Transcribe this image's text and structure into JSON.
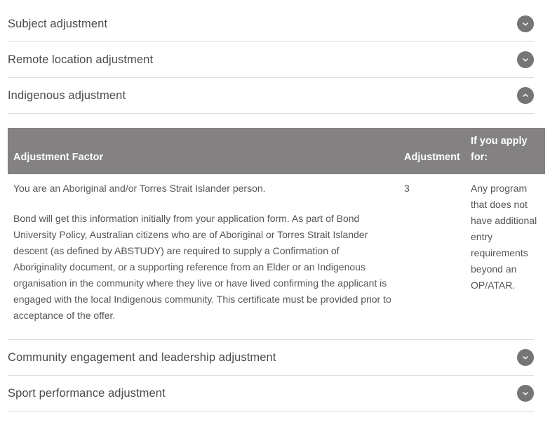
{
  "accordion": {
    "items": [
      {
        "title": "Subject adjustment",
        "expanded": false,
        "icon": "chevron-down-icon"
      },
      {
        "title": "Remote location adjustment",
        "expanded": false,
        "icon": "chevron-down-icon"
      },
      {
        "title": "Indigenous adjustment",
        "expanded": true,
        "icon": "chevron-up-icon"
      },
      {
        "title": "Community engagement and leadership adjustment",
        "expanded": false,
        "icon": "chevron-down-icon"
      },
      {
        "title": "Sport performance adjustment",
        "expanded": false,
        "icon": "chevron-down-icon"
      }
    ]
  },
  "indigenous_table": {
    "headers": [
      "Adjustment Factor",
      "Adjustment",
      "If you apply for:"
    ],
    "rows": [
      {
        "factor_paragraphs": [
          "You are an Aboriginal and/or Torres Strait Islander person.",
          "Bond will get this information initially from your application form. As part of Bond University Policy, Australian citizens who are of Aboriginal or Torres Strait Islander descent (as defined by ABSTUDY) are required to supply a Confirmation of Aboriginality document, or a supporting reference from an Elder or an Indigenous organisation in the community where they live or have lived confirming the applicant is engaged with the local Indigenous community. This certificate must be provided prior to acceptance of the offer."
        ],
        "adjustment": "3",
        "applies_to": "Any program that does not have additional entry requirements beyond an OP/ATAR."
      }
    ]
  },
  "colors": {
    "table_header_bg": "#838181",
    "chevron_bg": "#757575",
    "divider": "#dddddd",
    "text": "#555555"
  }
}
